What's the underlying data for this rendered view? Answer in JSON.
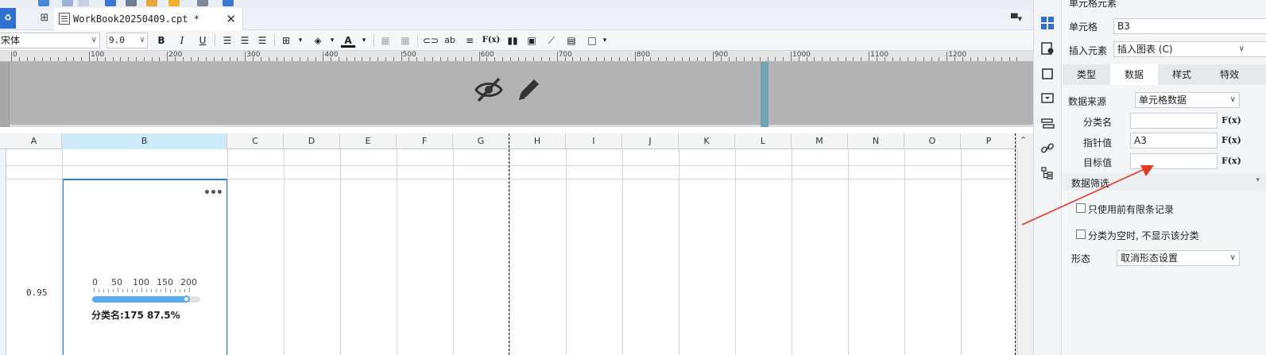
{
  "toolbar": {
    "tab_title": "WorkBook20250409.cpt *",
    "font_name": "宋体",
    "font_size": "9.0",
    "bold": "B",
    "italic": "I",
    "underline": "U",
    "text_btn": "ab",
    "formula_btn": "F(x)",
    "accent_color": "#2f6fd0"
  },
  "ruler": {
    "labels": [
      "0",
      "100",
      "200",
      "300",
      "400",
      "500",
      "600",
      "700",
      "800",
      "900",
      "1000",
      "1100",
      "1200"
    ]
  },
  "sheet": {
    "columns": [
      "A",
      "B",
      "C",
      "D",
      "E",
      "F",
      "G",
      "H",
      "I",
      "J",
      "K",
      "L",
      "M",
      "N",
      "O",
      "P"
    ],
    "active_column": "B",
    "cell_a3": "0.95"
  },
  "gauge": {
    "labels": [
      "0",
      "50",
      "100",
      "150",
      "200"
    ],
    "value": 175,
    "max": 200,
    "fraction": 0.875,
    "caption": "分类名:175 87.5%",
    "more": "•••",
    "fill_color": "#5aaaf0"
  },
  "panel": {
    "title": "单元格元素",
    "cell_label": "单元格",
    "cell_value": "B3",
    "insert_label": "插入元素",
    "insert_value": "插入图表 (C)",
    "tabs": [
      "类型",
      "数据",
      "样式",
      "特效"
    ],
    "active_tab": "数据",
    "source_label": "数据来源",
    "source_value": "单元格数据",
    "category_label": "分类名",
    "category_value": "",
    "pointer_label": "指针值",
    "pointer_value": "A3",
    "target_label": "目标值",
    "target_value": "",
    "fx": "F(x)",
    "filter_title": "数据筛选",
    "opt_limited": "只使用前有限条记录",
    "opt_hide_empty": "分类为空时, 不显示该分类",
    "form_label": "形态",
    "form_value": "取消形态设置"
  },
  "annotation": {
    "arrow_color": "#e53a2a"
  }
}
